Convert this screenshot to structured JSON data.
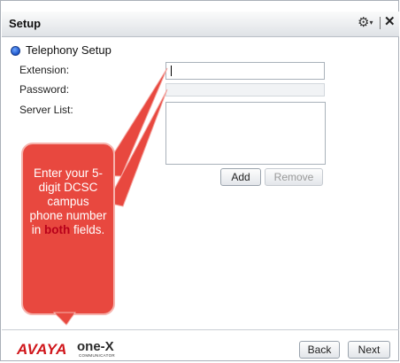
{
  "window": {
    "title": "Setup",
    "settings_icon": "gear-icon",
    "close_icon": "close-icon"
  },
  "section": {
    "label": "Telephony Setup"
  },
  "form": {
    "extension_label": "Extension:",
    "extension_value": "",
    "password_label": "Password:",
    "password_value": "",
    "server_list_label": "Server List:",
    "server_list_items": []
  },
  "buttons": {
    "add": "Add",
    "remove": "Remove",
    "back": "Back",
    "next": "Next"
  },
  "callout": {
    "text_before": "Enter your 5-digit DCSC campus phone number in ",
    "emphasis": "both",
    "text_after": " fields.",
    "fill_color": "#e8483f",
    "emphasis_color": "#b8001a"
  },
  "brand": {
    "name": "AVAYA",
    "product": "one-X",
    "tagline": "COMMUNICATOR",
    "color": "#d0161b"
  }
}
